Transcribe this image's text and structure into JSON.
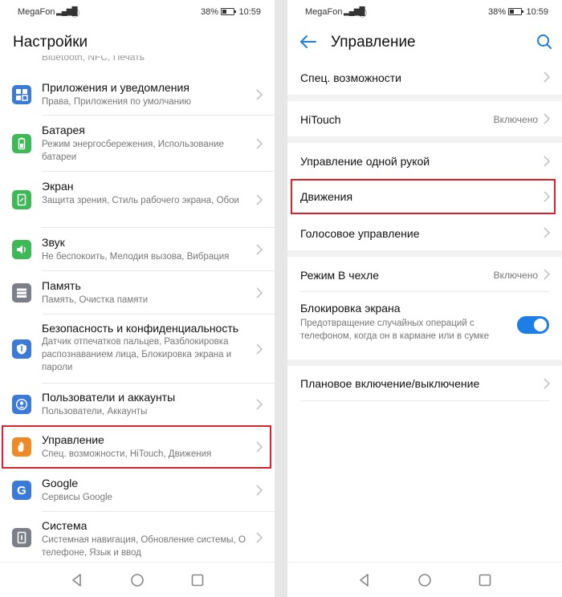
{
  "status": {
    "carrier": "MegaFon",
    "battery": "38%",
    "time": "10:59"
  },
  "left": {
    "title": "Настройки",
    "cut_text": "Bluetooth, NFC, Печать",
    "items": [
      {
        "title": "Приложения и уведомления",
        "subtitle": "Права, Приложения по умолчанию",
        "icon": "apps-icon",
        "color": "#3a7ad9"
      },
      {
        "title": "Батарея",
        "subtitle": "Режим энергосбережения, Использование батареи",
        "icon": "battery-icon",
        "color": "#3dba56"
      },
      {
        "title": "Экран",
        "subtitle": "Защита зрения, Стиль рабочего экрана, Обои",
        "icon": "display-icon",
        "color": "#3dba56"
      },
      {
        "title": "Звук",
        "subtitle": "Не беспокоить, Мелодия вызова, Вибрация",
        "icon": "sound-icon",
        "color": "#3dba56"
      },
      {
        "title": "Память",
        "subtitle": "Память, Очистка памяти",
        "icon": "storage-icon",
        "color": "#7a7f88"
      },
      {
        "title": "Безопасность и конфиденциальность",
        "subtitle": "Датчик отпечатков пальцев, Разблокировка распознаванием лица, Блокировка экрана и пароли",
        "icon": "shield-icon",
        "color": "#3a7ad9"
      },
      {
        "title": "Пользователи и аккаунты",
        "subtitle": "Пользователи, Аккаунты",
        "icon": "user-icon",
        "color": "#3a7ad9"
      },
      {
        "title": "Управление",
        "subtitle": "Спец. возможности, HiTouch, Движения",
        "icon": "hand-icon",
        "color": "#f08a24"
      },
      {
        "title": "Google",
        "subtitle": "Сервисы Google",
        "icon": "google-icon",
        "color": "#3a7ad9"
      },
      {
        "title": "Система",
        "subtitle": "Системная навигация, Обновление системы, О телефоне, Язык и ввод",
        "icon": "system-icon",
        "color": "#7a7f88"
      }
    ]
  },
  "right": {
    "title": "Управление",
    "items": [
      {
        "title": "Спец. возможности"
      },
      {
        "title": "HiTouch",
        "value": "Включено"
      },
      {
        "title": "Управление одной рукой"
      },
      {
        "title": "Движения"
      },
      {
        "title": "Голосовое управление"
      },
      {
        "title": "Режим В чехле",
        "value": "Включено"
      },
      {
        "title": "Блокировка экрана",
        "subtitle": "Предотвращение случайных операций с телефоном, когда он в кармане или в сумке",
        "toggle_on": true
      },
      {
        "title": "Плановое включение/выключение"
      }
    ]
  },
  "colors": {
    "accent": "#1d7ee6",
    "highlight": "#d9202b"
  }
}
